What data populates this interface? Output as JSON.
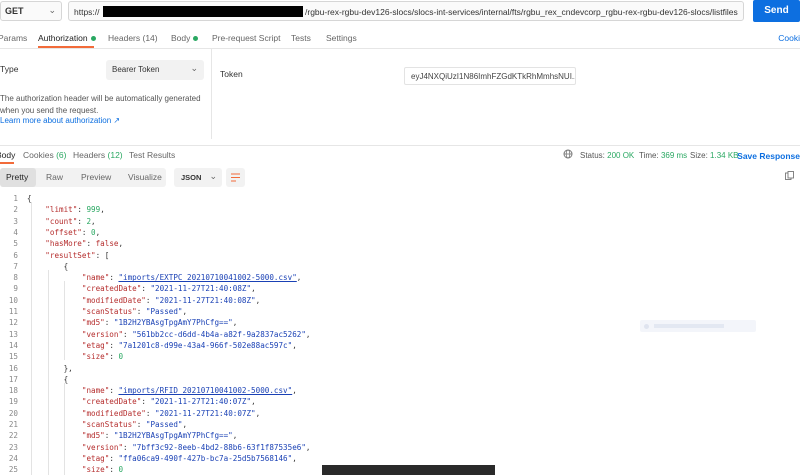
{
  "request": {
    "method": "GET",
    "url_scheme": "https://",
    "url_path": "/rgbu-rex-rgbu-dev126-slocs/slocs-int-services/internal/fts/rgbu_rex_cndevcorp_rgbu-rex-rgbu-dev126-slocs/listfiles",
    "send_label": "Send"
  },
  "request_tabs": {
    "params": "Params",
    "authorization": "Authorization",
    "headers": "Headers (14)",
    "body": "Body",
    "pre_request": "Pre-request Script",
    "tests": "Tests",
    "settings": "Settings",
    "cookies": "Cooki"
  },
  "auth": {
    "type_label": "Type",
    "type_value": "Bearer Token",
    "desc_line1": "The authorization header will be automatically generated",
    "desc_line2": "when you send the request.",
    "learn_more": "Learn more about authorization ↗",
    "token_label": "Token",
    "token_value": "eyJ4NXQiUzI1N86ImhFZGdKTkRhMmhsNUI..."
  },
  "response_tabs": {
    "body": "Body",
    "cookies_label": "Cookies",
    "cookies_count": "(6)",
    "headers_label": "Headers",
    "headers_count": "(12)",
    "test_results": "Test Results",
    "status_label": "Status:",
    "status_value": "200 OK",
    "time_label": "Time:",
    "time_value": "369 ms",
    "size_label": "Size:",
    "size_value": "1.34 KB",
    "save_response": "Save Response"
  },
  "toolbar": {
    "pretty": "Pretty",
    "raw": "Raw",
    "preview": "Preview",
    "visualize": "Visualize",
    "format": "JSON"
  },
  "colors": {
    "accent": "#f26b3a",
    "send": "#0d6fe0",
    "ok": "#2aa862",
    "json_key": "#b52d2d",
    "json_string": "#1a41b5",
    "json_number": "#2aa862"
  },
  "icons": {
    "method_chevron": "chevron-down-icon",
    "globe": "globe-icon",
    "wrap": "wrap-lines-icon",
    "copy": "copy-icon"
  },
  "code_lines": [
    {
      "n": "1",
      "t": [
        {
          "c": "p",
          "v": "{"
        }
      ]
    },
    {
      "n": "2",
      "t": [
        {
          "c": "p",
          "v": "    "
        },
        {
          "c": "k",
          "v": "\"limit\""
        },
        {
          "c": "p",
          "v": ": "
        },
        {
          "c": "n",
          "v": "999"
        },
        {
          "c": "p",
          "v": ","
        }
      ]
    },
    {
      "n": "3",
      "t": [
        {
          "c": "p",
          "v": "    "
        },
        {
          "c": "k",
          "v": "\"count\""
        },
        {
          "c": "p",
          "v": ": "
        },
        {
          "c": "n",
          "v": "2"
        },
        {
          "c": "p",
          "v": ","
        }
      ]
    },
    {
      "n": "4",
      "t": [
        {
          "c": "p",
          "v": "    "
        },
        {
          "c": "k",
          "v": "\"offset\""
        },
        {
          "c": "p",
          "v": ": "
        },
        {
          "c": "n",
          "v": "0"
        },
        {
          "c": "p",
          "v": ","
        }
      ]
    },
    {
      "n": "5",
      "t": [
        {
          "c": "p",
          "v": "    "
        },
        {
          "c": "k",
          "v": "\"hasMore\""
        },
        {
          "c": "p",
          "v": ": "
        },
        {
          "c": "kw",
          "v": "false"
        },
        {
          "c": "p",
          "v": ","
        }
      ]
    },
    {
      "n": "6",
      "t": [
        {
          "c": "p",
          "v": "    "
        },
        {
          "c": "k",
          "v": "\"resultSet\""
        },
        {
          "c": "p",
          "v": ": ["
        }
      ]
    },
    {
      "n": "7",
      "t": [
        {
          "c": "p",
          "v": "        {"
        }
      ]
    },
    {
      "n": "8",
      "t": [
        {
          "c": "p",
          "v": "            "
        },
        {
          "c": "k",
          "v": "\"name\""
        },
        {
          "c": "p",
          "v": ": "
        },
        {
          "c": "sl",
          "v": "\"imports/EXTPC_20210710041002-5000.csv\""
        },
        {
          "c": "p",
          "v": ","
        }
      ]
    },
    {
      "n": "9",
      "t": [
        {
          "c": "p",
          "v": "            "
        },
        {
          "c": "k",
          "v": "\"createdDate\""
        },
        {
          "c": "p",
          "v": ": "
        },
        {
          "c": "s",
          "v": "\"2021-11-27T21:40:08Z\""
        },
        {
          "c": "p",
          "v": ","
        }
      ]
    },
    {
      "n": "10",
      "t": [
        {
          "c": "p",
          "v": "            "
        },
        {
          "c": "k",
          "v": "\"modifiedDate\""
        },
        {
          "c": "p",
          "v": ": "
        },
        {
          "c": "s",
          "v": "\"2021-11-27T21:40:08Z\""
        },
        {
          "c": "p",
          "v": ","
        }
      ]
    },
    {
      "n": "11",
      "t": [
        {
          "c": "p",
          "v": "            "
        },
        {
          "c": "k",
          "v": "\"scanStatus\""
        },
        {
          "c": "p",
          "v": ": "
        },
        {
          "c": "s",
          "v": "\"Passed\""
        },
        {
          "c": "p",
          "v": ","
        }
      ]
    },
    {
      "n": "12",
      "t": [
        {
          "c": "p",
          "v": "            "
        },
        {
          "c": "k",
          "v": "\"md5\""
        },
        {
          "c": "p",
          "v": ": "
        },
        {
          "c": "s",
          "v": "\"1B2H2YBAsgTpgAmY7PhCfg==\""
        },
        {
          "c": "p",
          "v": ","
        }
      ]
    },
    {
      "n": "13",
      "t": [
        {
          "c": "p",
          "v": "            "
        },
        {
          "c": "k",
          "v": "\"version\""
        },
        {
          "c": "p",
          "v": ": "
        },
        {
          "c": "s",
          "v": "\"561bb2cc-d6dd-4b4a-a82f-9a2837ac5262\""
        },
        {
          "c": "p",
          "v": ","
        }
      ]
    },
    {
      "n": "14",
      "t": [
        {
          "c": "p",
          "v": "            "
        },
        {
          "c": "k",
          "v": "\"etag\""
        },
        {
          "c": "p",
          "v": ": "
        },
        {
          "c": "s",
          "v": "\"7a1201c8-d99e-43a4-966f-502e88ac597c\""
        },
        {
          "c": "p",
          "v": ","
        }
      ]
    },
    {
      "n": "15",
      "t": [
        {
          "c": "p",
          "v": "            "
        },
        {
          "c": "k",
          "v": "\"size\""
        },
        {
          "c": "p",
          "v": ": "
        },
        {
          "c": "n",
          "v": "0"
        }
      ]
    },
    {
      "n": "16",
      "t": [
        {
          "c": "p",
          "v": "        },"
        }
      ]
    },
    {
      "n": "17",
      "t": [
        {
          "c": "p",
          "v": "        {"
        }
      ]
    },
    {
      "n": "18",
      "t": [
        {
          "c": "p",
          "v": "            "
        },
        {
          "c": "k",
          "v": "\"name\""
        },
        {
          "c": "p",
          "v": ": "
        },
        {
          "c": "sl",
          "v": "\"imports/RFID_20210710041002-5000.csv\""
        },
        {
          "c": "p",
          "v": ","
        }
      ]
    },
    {
      "n": "19",
      "t": [
        {
          "c": "p",
          "v": "            "
        },
        {
          "c": "k",
          "v": "\"createdDate\""
        },
        {
          "c": "p",
          "v": ": "
        },
        {
          "c": "s",
          "v": "\"2021-11-27T21:40:07Z\""
        },
        {
          "c": "p",
          "v": ","
        }
      ]
    },
    {
      "n": "20",
      "t": [
        {
          "c": "p",
          "v": "            "
        },
        {
          "c": "k",
          "v": "\"modifiedDate\""
        },
        {
          "c": "p",
          "v": ": "
        },
        {
          "c": "s",
          "v": "\"2021-11-27T21:40:07Z\""
        },
        {
          "c": "p",
          "v": ","
        }
      ]
    },
    {
      "n": "21",
      "t": [
        {
          "c": "p",
          "v": "            "
        },
        {
          "c": "k",
          "v": "\"scanStatus\""
        },
        {
          "c": "p",
          "v": ": "
        },
        {
          "c": "s",
          "v": "\"Passed\""
        },
        {
          "c": "p",
          "v": ","
        }
      ]
    },
    {
      "n": "22",
      "t": [
        {
          "c": "p",
          "v": "            "
        },
        {
          "c": "k",
          "v": "\"md5\""
        },
        {
          "c": "p",
          "v": ": "
        },
        {
          "c": "s",
          "v": "\"1B2H2YBAsgTpgAmY7PhCfg==\""
        },
        {
          "c": "p",
          "v": ","
        }
      ]
    },
    {
      "n": "23",
      "t": [
        {
          "c": "p",
          "v": "            "
        },
        {
          "c": "k",
          "v": "\"version\""
        },
        {
          "c": "p",
          "v": ": "
        },
        {
          "c": "s",
          "v": "\"7bff3c92-8eeb-4bd2-88b6-63f1f87535e6\""
        },
        {
          "c": "p",
          "v": ","
        }
      ]
    },
    {
      "n": "24",
      "t": [
        {
          "c": "p",
          "v": "            "
        },
        {
          "c": "k",
          "v": "\"etag\""
        },
        {
          "c": "p",
          "v": ": "
        },
        {
          "c": "s",
          "v": "\"ffa06ca9-490f-427b-bc7a-25d5b7568146\""
        },
        {
          "c": "p",
          "v": ","
        }
      ]
    },
    {
      "n": "25",
      "t": [
        {
          "c": "p",
          "v": "            "
        },
        {
          "c": "k",
          "v": "\"size\""
        },
        {
          "c": "p",
          "v": ": "
        },
        {
          "c": "n",
          "v": "0"
        }
      ]
    }
  ]
}
